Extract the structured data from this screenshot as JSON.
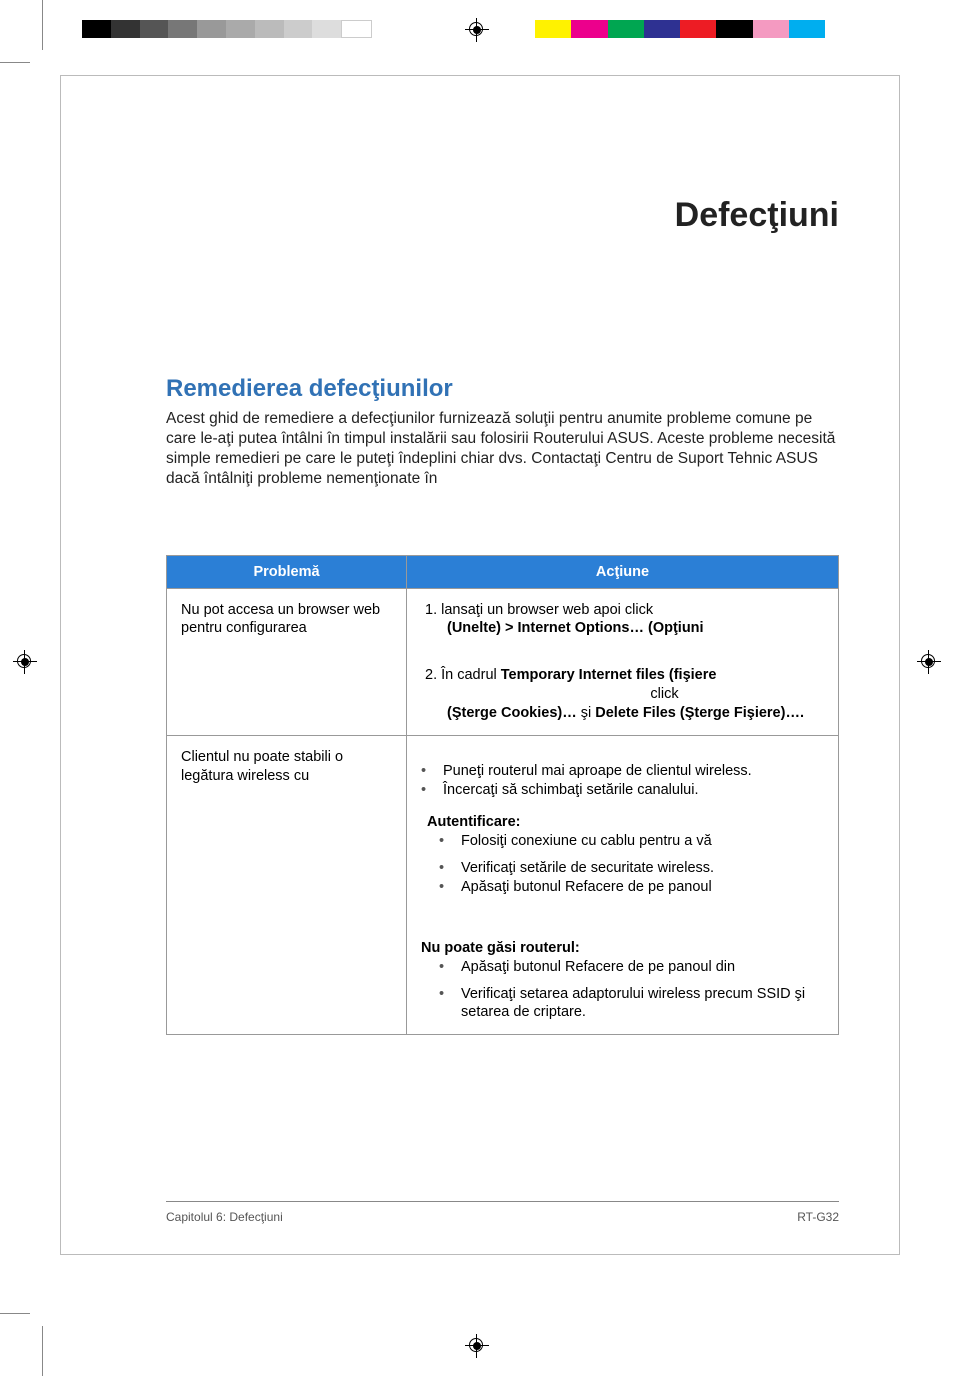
{
  "printer_marks": {
    "gray_bar": [
      "#000",
      "#333",
      "#555",
      "#777",
      "#999",
      "#aaa",
      "#bbb",
      "#ccc",
      "#ddd",
      "#fff"
    ],
    "color_bar": [
      "#fff200",
      "#ec008c",
      "#00a651",
      "#2e3192",
      "#ed1c24",
      "#000000",
      "#f49ac1",
      "#00aeef"
    ]
  },
  "chapter_title": "Defecţiuni",
  "section_title": "Remedierea defecţiunilor",
  "intro_text": "Acest ghid de remediere a defecţiunilor furnizează soluţii pentru anumite probleme comune pe care le-aţi putea întâlni în timpul instalării sau folosirii Routerului ASUS. Aceste probleme necesită simple remedieri pe care le puteţi îndeplini chiar dvs. Contactaţi Centru de Suport Tehnic ASUS dacă întâlniţi probleme nemenţionate în",
  "table": {
    "headers": {
      "problem": "Problemă",
      "action": "Acţiune"
    },
    "rows": [
      {
        "problem": "Nu pot accesa un browser web pentru configurarea",
        "action": {
          "step1_prefix": "1.  lansaţi un browser web apoi click",
          "step1_bold": "(Unelte) > Internet Options… (Opţiuni",
          "step2_prefix": "2.  În cadrul ",
          "step2_bold_a": "Temporary Internet files (fişiere",
          "step2_mid": "click",
          "step2_bold_b": "(Şterge Cookies)…",
          "step2_and": " şi ",
          "step2_bold_c": "Delete Files (Şterge Fişiere)…."
        }
      },
      {
        "problem": "Clientul nu poate stabili o legătura wireless cu",
        "action": {
          "b1": "Puneţi routerul mai aproape de clientul wireless.",
          "b2": "Încercaţi să schimbaţi setările canalului.",
          "auth_title": "Autentificare:",
          "b3": "Folosiţi conexiune cu cablu pentru a vă",
          "b4": "Verificaţi setările de securitate wireless.",
          "b5": "Apăsaţi butonul Refacere de pe panoul",
          "norouter_title": "Nu poate găsi routerul:",
          "b6": "Apăsaţi butonul Refacere de pe panoul din",
          "b7": "Verificaţi setarea adaptorului wireless precum SSID şi setarea de criptare."
        }
      }
    ]
  },
  "footer": {
    "left": "Capitolul 6: Defecţiuni",
    "right": "RT-G32"
  }
}
